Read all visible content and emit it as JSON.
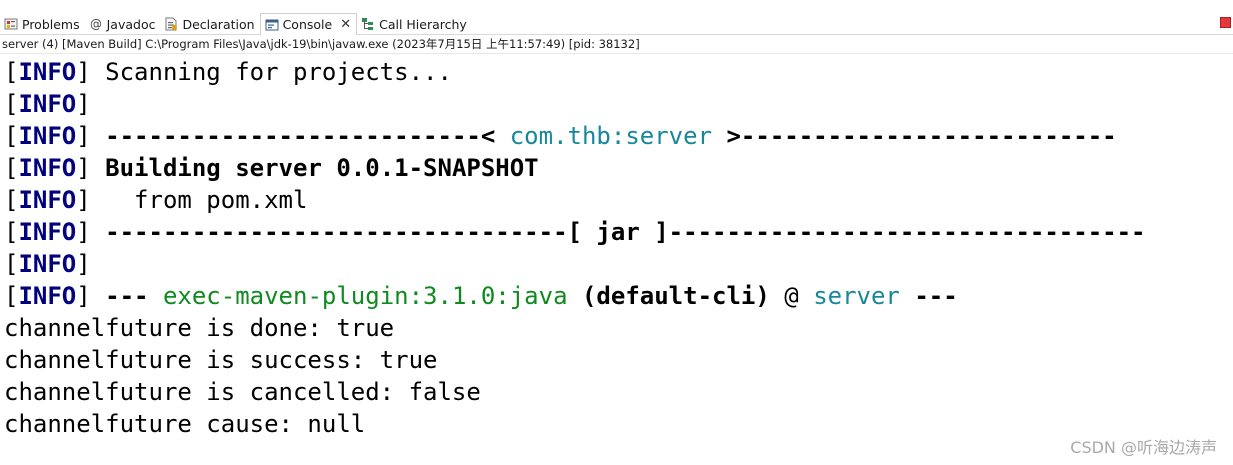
{
  "tabs": [
    {
      "label": "Problems",
      "icon": "problems-icon",
      "active": false
    },
    {
      "label": "Javadoc",
      "icon": "at-icon",
      "active": false
    },
    {
      "label": "Declaration",
      "icon": "declaration-icon",
      "active": false
    },
    {
      "label": "Console",
      "icon": "console-icon",
      "active": true
    },
    {
      "label": "Call Hierarchy",
      "icon": "call-hierarchy-icon",
      "active": false
    }
  ],
  "console_close_glyph": "✕",
  "launch_description": "server (4) [Maven Build] C:\\Program Files\\Java\\jdk-19\\bin\\javaw.exe  (2023年7月15日 上午11:57:49) [pid: 38132]",
  "console": {
    "lines": [
      {
        "segments": [
          {
            "text": "[",
            "style": "plain"
          },
          {
            "text": "INFO",
            "style": "info-level"
          },
          {
            "text": "] Scanning for projects...",
            "style": "plain"
          }
        ]
      },
      {
        "segments": [
          {
            "text": "[",
            "style": "plain"
          },
          {
            "text": "INFO",
            "style": "info-level"
          },
          {
            "text": "]",
            "style": "plain"
          }
        ]
      },
      {
        "segments": [
          {
            "text": "[",
            "style": "plain"
          },
          {
            "text": "INFO",
            "style": "info-level"
          },
          {
            "text": "] ",
            "style": "plain"
          },
          {
            "text": "--------------------------< ",
            "style": "bold"
          },
          {
            "text": "com.thb:server",
            "style": "teal"
          },
          {
            "text": " >--------------------------",
            "style": "bold"
          }
        ]
      },
      {
        "segments": [
          {
            "text": "[",
            "style": "plain"
          },
          {
            "text": "INFO",
            "style": "info-level"
          },
          {
            "text": "] ",
            "style": "plain"
          },
          {
            "text": "Building server 0.0.1-SNAPSHOT",
            "style": "bold"
          }
        ]
      },
      {
        "segments": [
          {
            "text": "[",
            "style": "plain"
          },
          {
            "text": "INFO",
            "style": "info-level"
          },
          {
            "text": "]   from pom.xml",
            "style": "plain"
          }
        ]
      },
      {
        "segments": [
          {
            "text": "[",
            "style": "plain"
          },
          {
            "text": "INFO",
            "style": "info-level"
          },
          {
            "text": "] ",
            "style": "plain"
          },
          {
            "text": "--------------------------------[ jar ]---------------------------------",
            "style": "bold"
          }
        ]
      },
      {
        "segments": [
          {
            "text": "[",
            "style": "plain"
          },
          {
            "text": "INFO",
            "style": "info-level"
          },
          {
            "text": "]",
            "style": "plain"
          }
        ]
      },
      {
        "segments": [
          {
            "text": "[",
            "style": "plain"
          },
          {
            "text": "INFO",
            "style": "info-level"
          },
          {
            "text": "] ",
            "style": "plain"
          },
          {
            "text": "--- ",
            "style": "bold"
          },
          {
            "text": "exec-maven-plugin:3.1.0:java",
            "style": "green"
          },
          {
            "text": " (default-cli)",
            "style": "bold"
          },
          {
            "text": " @ ",
            "style": "plain"
          },
          {
            "text": "server",
            "style": "teal"
          },
          {
            "text": " ---",
            "style": "bold"
          }
        ]
      },
      {
        "segments": [
          {
            "text": "channelfuture is done: true",
            "style": "plain"
          }
        ]
      },
      {
        "segments": [
          {
            "text": "channelfuture is success: true",
            "style": "plain"
          }
        ]
      },
      {
        "segments": [
          {
            "text": "channelfuture is cancelled: false",
            "style": "plain"
          }
        ]
      },
      {
        "segments": [
          {
            "text": "channelfuture cause: null",
            "style": "plain"
          }
        ]
      }
    ]
  },
  "watermark": "CSDN @听海边涛声",
  "colors": {
    "info_level": "#000080",
    "teal": "#17889a",
    "green": "#0f8a1f",
    "stop_button": "#e0393e"
  }
}
